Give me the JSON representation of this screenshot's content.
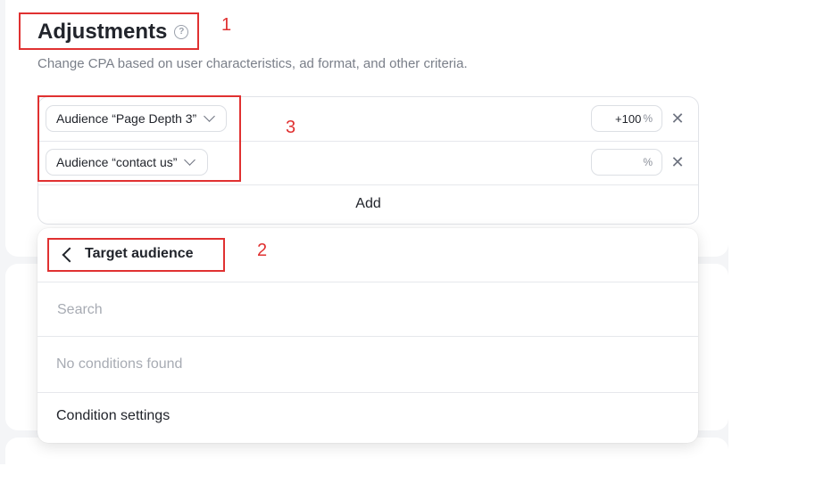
{
  "section": {
    "title": "Adjustments",
    "help_icon": "question-circle-icon",
    "subtitle": "Change CPA based on user characteristics, ad format, and other criteria."
  },
  "adjustments": {
    "rows": [
      {
        "audience": "Audience “Page Depth 3”",
        "value": "+100",
        "unit": "%"
      },
      {
        "audience": "Audience “contact us”",
        "value": "",
        "unit": "%"
      }
    ],
    "remove_icon": "close-icon",
    "add_label": "Add"
  },
  "dropdown": {
    "back_icon": "chevron-left-icon",
    "title": "Target audience",
    "search_placeholder": "Search",
    "empty_text": "No conditions found",
    "settings_label": "Condition settings"
  },
  "annotations": [
    "1",
    "2",
    "3"
  ],
  "colors": {
    "annotation": "#e03131",
    "background": "#f4f5f7",
    "card": "#ffffff"
  }
}
